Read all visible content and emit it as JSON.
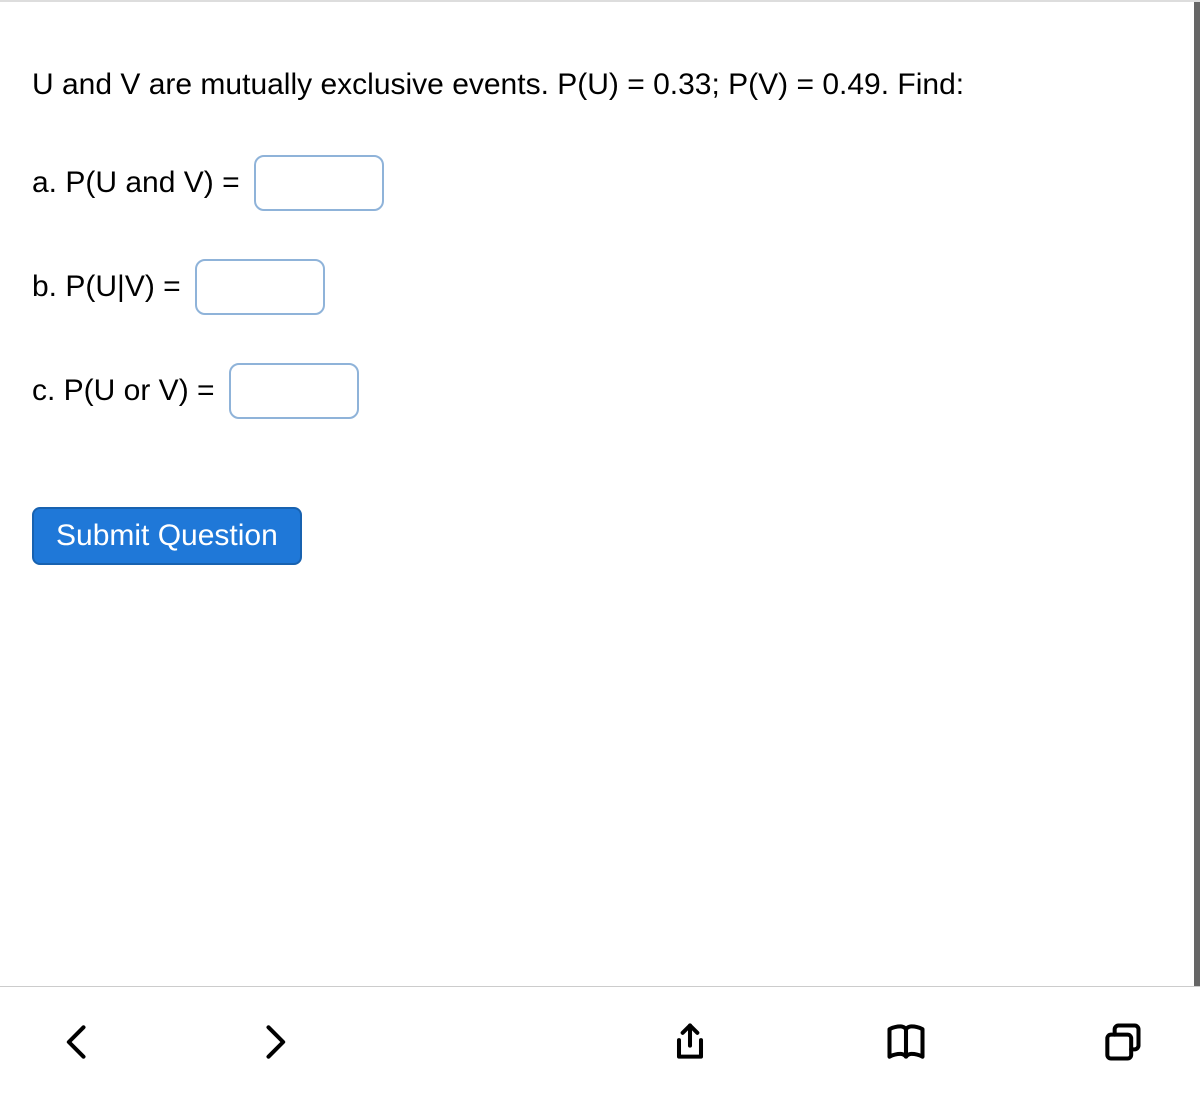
{
  "question": {
    "prompt": "U and V are mutually exclusive events. P(U) = 0.33; P(V) = 0.49. Find:",
    "parts": {
      "a": {
        "label": "a.  P(U and V) =",
        "value": ""
      },
      "b": {
        "label": "b.   P(U|V) =",
        "value": ""
      },
      "c": {
        "label": "c.  P(U or V) =",
        "value": ""
      }
    }
  },
  "buttons": {
    "submit": "Submit Question"
  },
  "toolbar": {
    "back": "back-icon",
    "forward": "forward-icon",
    "share": "share-icon",
    "book": "book-icon",
    "tabs": "tabs-icon"
  }
}
